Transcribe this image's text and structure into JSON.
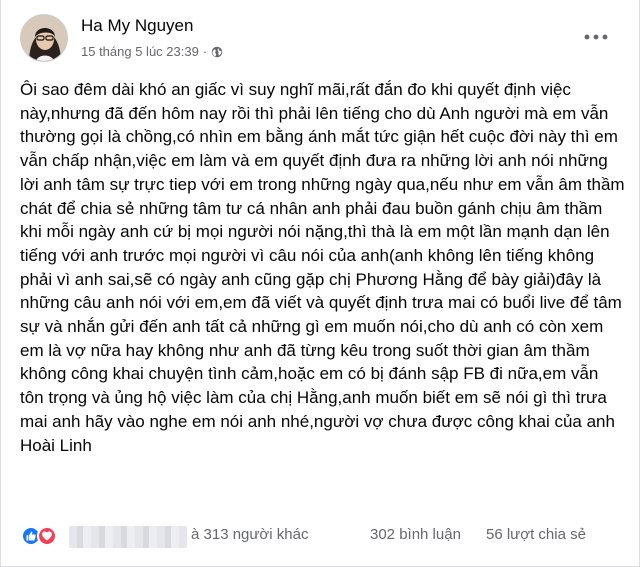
{
  "post": {
    "author": "Ha My Nguyen",
    "timestamp": "15 tháng 5 lúc 23:39",
    "separator": "·",
    "audience_icon": "globe-icon",
    "more_icon": "more-icon",
    "text": "Ôi sao đêm dài khó an giấc vì suy nghĩ mãi,rất đắn đo khi quyết định việc này,nhưng đã đến hôm nay rồi thì phải lên tiếng cho dù Anh người mà em vẫn thường gọi là chồng,có nhìn em bằng ánh mắt tức giận hết cuộc đời này thì em vẫn chấp nhận,việc em làm và em quyết định đưa ra những lời anh nói những lời anh tâm sự trực tiep với em trong những ngày qua,nếu như em vẫn âm thầm chát để chia sẻ những tâm tư cá nhân anh phải đau buồn gánh chịu âm thầm khi mỗi ngày anh cứ bị mọi người nói nặng,thì thà là em một lần mạnh dạn lên tiếng với anh trước mọi người vì câu nói của anh(anh không lên tiếng không phải vì anh sai,sẽ có ngày anh cũng gặp chị Phương Hằng để bày giải)đây là những câu anh nói với em,em đã viết và quyết định trưa mai có buổi live để tâm sự và nhắn gửi đến anh tất cả những gì em muốn nói,cho dù anh có còn xem em là vợ nữa hay không như anh đã từng kêu trong suốt thời gian âm thầm không công khai chuyện tình cảm,hoặc em có bị đánh sập FB đi nữa,em vẫn tôn trọng và ủng hộ việc làm của chị Hằng,anh muốn biết em sẽ nói gì thì trưa mai anh hãy vào nghe em nói anh nhé,người vợ chưa được công khai của anh Hoài Linh"
  },
  "footer": {
    "reaction_icons": [
      "like-icon",
      "love-icon"
    ],
    "others_text": "à 313 người khác",
    "comments_text": "302 bình luận",
    "shares_text": "56 lượt chia sẻ"
  },
  "colors": {
    "like": "#1877f2",
    "love": "#f33e58",
    "secondary_text": "#65676b"
  }
}
